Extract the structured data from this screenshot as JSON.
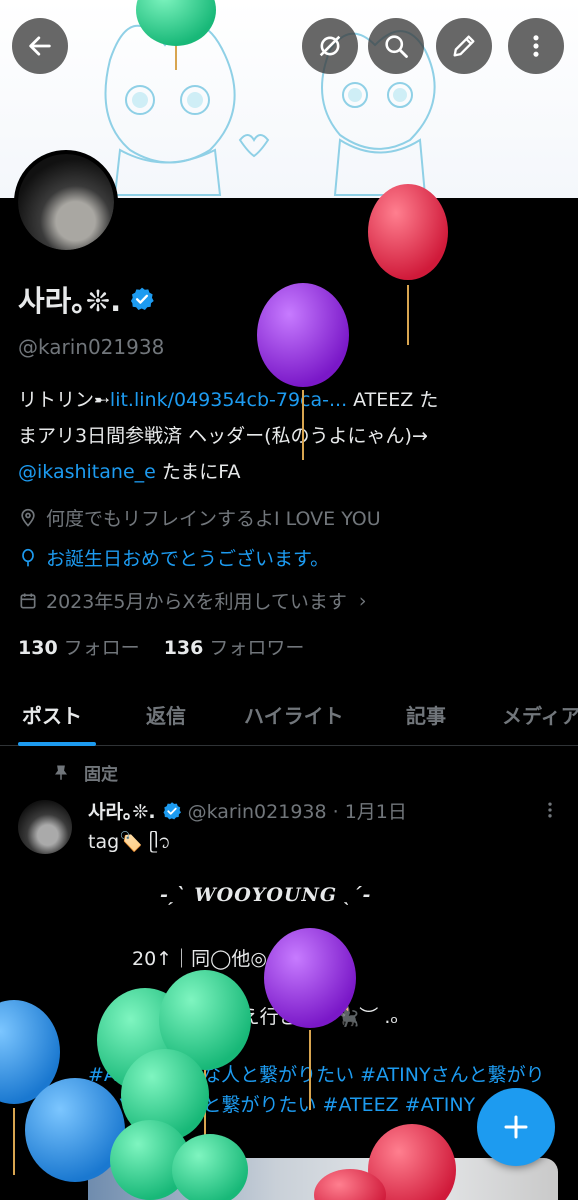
{
  "profile": {
    "display_name": "사라｡❊.",
    "handle": "@karin021938",
    "bio_prefix": "リトリン➸",
    "bio_link": "lit.link/049354cb-79ca-...",
    "bio_line1_suffix": " ATEEZ た",
    "bio_line2": "まアリ3日間参戦済 ヘッダー(私のうよにゃん)→",
    "bio_mention": "@ikashitane_e",
    "bio_line3_suffix": " たまにFA",
    "location": "何度でもリフレインするよI LOVE YOU",
    "birthday": "お誕生日おめでとうございます。",
    "joined": "2023年5月からXを利用しています",
    "following_count": "130",
    "following_label": "フォロー",
    "followers_count": "136",
    "followers_label": "フォロワー"
  },
  "tabs": [
    {
      "label": "ポスト",
      "active": true
    },
    {
      "label": "返信",
      "active": false
    },
    {
      "label": "ハイライト",
      "active": false
    },
    {
      "label": "記事",
      "active": false
    },
    {
      "label": "メディア",
      "active": false
    }
  ],
  "pinned_post": {
    "pinned_label": "固定",
    "author_name": "사라｡❊.",
    "meta": "@karin021938 · 1月1日",
    "line_tag": "tag🏷️ ᥫ᭡",
    "line_woo": "-ˏˋ 𝑾𝑶𝑶𝒀𝑶𝑼𝑵𝑮 ˎˊ-",
    "line_age": "20↑｜同◯他◎｜ﾘﾄﾘﾝ有",
    "line_gray": "♡ or ☆ でお迎え行きます🐈‍⬛︶ .ₒ",
    "hashtags": "#ATEEZ好きな人と繋がりたい #ATINYさんと繋がりたい #ATINYと繋がりたい  #ATEEZ #ATINY"
  },
  "icons": {
    "back": "back-arrow-icon",
    "no_notify": "notification-off-icon",
    "search": "search-icon",
    "edit": "edit-pencil-icon",
    "more": "more-vertical-icon",
    "verified": "verified-badge-icon",
    "location": "location-pin-icon",
    "birthday": "balloon-icon",
    "calendar": "calendar-icon",
    "pin": "pin-icon",
    "compose": "plus-icon"
  },
  "colors": {
    "background": "#000000",
    "accent": "#1d9bf0",
    "text_primary": "#e7e9ea",
    "text_secondary": "#71767b"
  }
}
